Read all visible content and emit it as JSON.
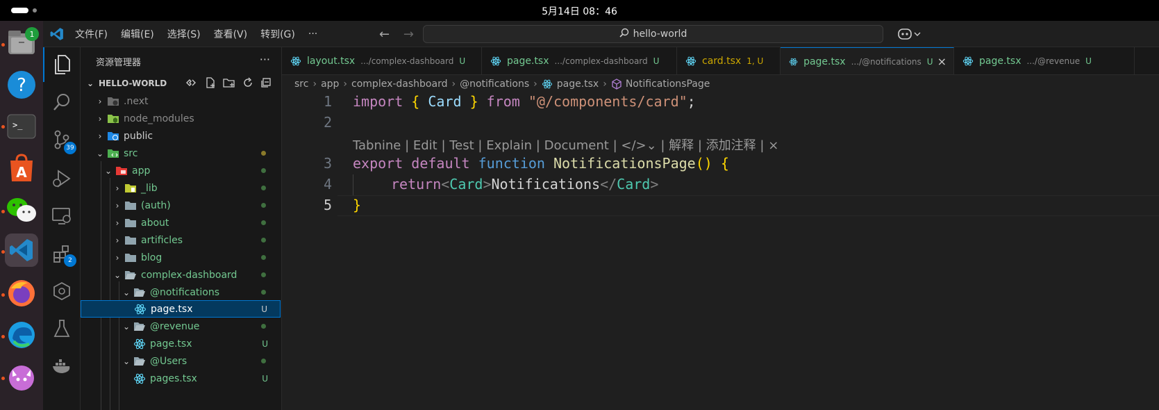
{
  "system": {
    "clock": "5月14日  08：46"
  },
  "dock": {
    "badges": {
      "files": "1"
    },
    "items": [
      "files-app",
      "help-app",
      "terminal-app",
      "app-store",
      "wechat-app",
      "vscode-app",
      "firefox-app",
      "edge-app",
      "cat-app"
    ]
  },
  "menu": {
    "file": "文件(F)",
    "edit": "编辑(E)",
    "select": "选择(S)",
    "view": "查看(V)",
    "go": "转到(G)",
    "more": "···"
  },
  "search": {
    "text": "hello-world"
  },
  "activity": {
    "scm_badge": "39",
    "ext_badge": "2"
  },
  "explorer": {
    "title": "资源管理器",
    "more": "···",
    "root": "HELLO-WORLD",
    "items": [
      {
        "label": ".next"
      },
      {
        "label": "node_modules"
      },
      {
        "label": "public"
      },
      {
        "label": "src"
      },
      {
        "label": "app"
      },
      {
        "label": "_lib"
      },
      {
        "label": "(auth)"
      },
      {
        "label": "about"
      },
      {
        "label": "artificles"
      },
      {
        "label": "blog"
      },
      {
        "label": "complex-dashboard"
      },
      {
        "label": "@notifications"
      },
      {
        "label": "page.tsx",
        "mark": "U"
      },
      {
        "label": "@revenue"
      },
      {
        "label": "page.tsx",
        "mark": "U"
      },
      {
        "label": "@Users"
      },
      {
        "label": "pages.tsx",
        "mark": "U"
      }
    ]
  },
  "tabs": [
    {
      "name": "layout.tsx",
      "desc": ".../complex-dashboard",
      "status": "U"
    },
    {
      "name": "page.tsx",
      "desc": ".../complex-dashboard",
      "status": "U"
    },
    {
      "name": "card.tsx",
      "desc": "",
      "status": "1, U"
    },
    {
      "name": "page.tsx",
      "desc": ".../@notifications",
      "status": "U",
      "close": "×"
    },
    {
      "name": "page.tsx",
      "desc": ".../@revenue",
      "status": "U"
    }
  ],
  "breadcrumb": [
    "src",
    "app",
    "complex-dashboard",
    "@notifications",
    "page.tsx",
    "NotificationsPage"
  ],
  "editor": {
    "line_numbers": [
      "1",
      "2",
      "3",
      "4",
      "5"
    ],
    "codelens": "Tabnine | Edit | Test | Explain | Document | ",
    "codelens_tail": " | 解释 | 添加注释 | ×",
    "line1": {
      "import": "import",
      "ob": "{",
      "card": " Card ",
      "cb": "}",
      "from": " from ",
      "path": "\"@/components/card\"",
      "semi": ";"
    },
    "line3": {
      "export": "export",
      "default": " default",
      "function": " function",
      "name": " NotificationsPage",
      "parens": "()",
      "space": " ",
      "brace": "{"
    },
    "line4": {
      "return": "return",
      "lt": "<",
      "tag": "Card",
      "gt": ">",
      "text": "Notifications",
      "close_lt": "</",
      "close_tag": "Card",
      "close_gt": ">"
    },
    "line5": {
      "brace": "}"
    }
  },
  "colors": {
    "accent": "#0078d4",
    "untracked": "#73c991",
    "warning": "#cca700"
  }
}
